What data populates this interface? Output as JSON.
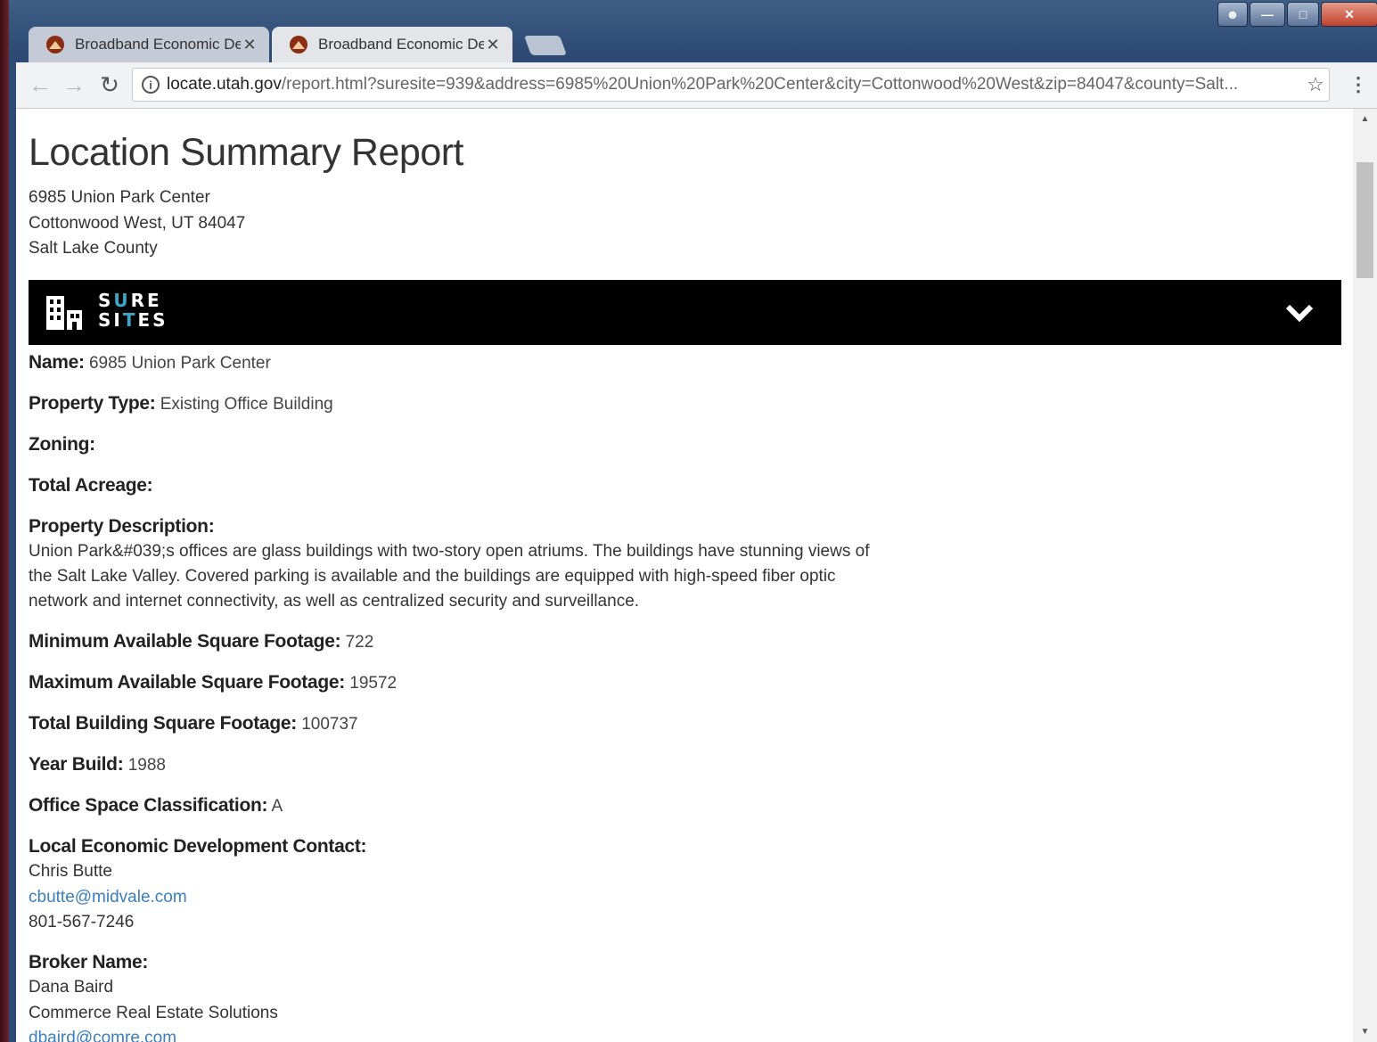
{
  "browser": {
    "tabs": [
      {
        "title": "Broadband Economic De",
        "active": false
      },
      {
        "title": "Broadband Economic De",
        "active": true
      }
    ],
    "url_host": "locate.utah.gov",
    "url_path": "/report.html?suresite=939&address=6985%20Union%20Park%20Center&city=Cottonwood%20West&zip=84047&county=Salt..."
  },
  "report": {
    "title": "Location Summary Report",
    "address_line1": "6985 Union Park Center",
    "address_line2": "Cottonwood West, UT 84047",
    "address_line3": "Salt Lake County",
    "logo_top": "SURE",
    "logo_bottom": "SITES",
    "fields": {
      "name_label": "Name:",
      "name_value": "6985 Union Park Center",
      "property_type_label": "Property Type:",
      "property_type_value": "Existing Office Building",
      "zoning_label": "Zoning:",
      "total_acreage_label": "Total Acreage:",
      "description_label": "Property Description:",
      "description_value": "Union Park&#039;s offices are glass buildings with two-story open atriums. The buildings have stunning views of the Salt Lake Valley. Covered parking is available and the buildings are equipped with high-speed fiber optic network and internet connectivity, as well as centralized security and surveillance.",
      "min_sqft_label": "Minimum Available Square Footage:",
      "min_sqft_value": "722",
      "max_sqft_label": "Maximum Available Square Footage:",
      "max_sqft_value": "19572",
      "total_sqft_label": "Total Building Square Footage:",
      "total_sqft_value": "100737",
      "year_label": "Year Build:",
      "year_value": "1988",
      "class_label": "Office Space Classification:",
      "class_value": "A",
      "contact_label": "Local Economic Development Contact:",
      "contact_name": "Chris Butte",
      "contact_email": "cbutte@midvale.com",
      "contact_phone": "801-567-7246",
      "broker_label": "Broker Name:",
      "broker_name": "Dana Baird",
      "broker_company": "Commerce Real Estate Solutions",
      "broker_email": "dbaird@comre.com"
    }
  }
}
